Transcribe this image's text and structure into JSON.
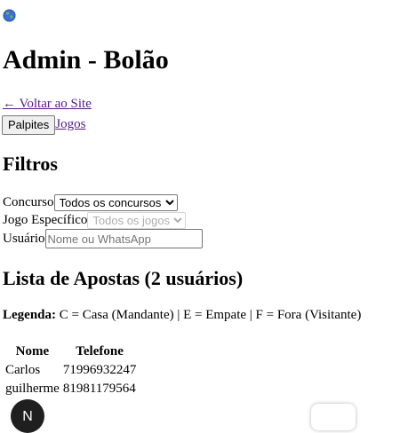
{
  "header": {
    "icon": "globe-icon",
    "title": "Admin - Bolão",
    "back_link": "← Voltar ao Site"
  },
  "nav": {
    "palpites_label": "Palpites",
    "jogos_label": "Jogos"
  },
  "filters": {
    "title": "Filtros",
    "concurso_label": "Concurso",
    "concurso_selected": "Todos os concursos",
    "jogo_label": "Jogo Específico",
    "jogo_selected": "Todos os jogos",
    "usuario_label": "Usuário",
    "usuario_placeholder": "Nome ou WhatsApp"
  },
  "list": {
    "title": "Lista de Apostas (2 usuários)",
    "legend_label": "Legenda:",
    "legend_text": " C = Casa (Mandante) | E = Empate | F = Fora (Visitante)",
    "columns": [
      "Nome",
      "Telefone"
    ],
    "rows": [
      {
        "nome": "Carlos",
        "telefone": "71996932247"
      },
      {
        "nome": "guilherme",
        "telefone": "81981179564"
      }
    ]
  },
  "floating": {
    "left_badge": "N"
  }
}
